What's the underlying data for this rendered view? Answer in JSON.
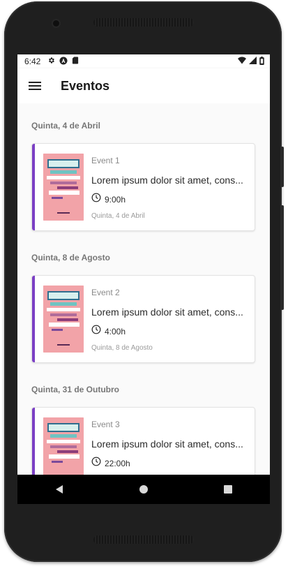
{
  "status_bar": {
    "time": "6:42",
    "icons": [
      "gear-icon",
      "a-badge-icon",
      "sd-card-icon"
    ],
    "right_icons": [
      "wifi-icon",
      "signal-icon",
      "battery-icon"
    ]
  },
  "app_bar": {
    "title": "Eventos",
    "menu_icon": "hamburger-menu-icon"
  },
  "events": [
    {
      "date_header": "Quinta, 4 de Abril",
      "name": "Event 1",
      "description": "Lorem ipsum dolor sit amet, cons...",
      "time": "9:00h",
      "date": "Quinta, 4 de Abril"
    },
    {
      "date_header": "Quinta, 8 de Agosto",
      "name": "Event 2",
      "description": "Lorem ipsum dolor sit amet, cons...",
      "time": "4:00h",
      "date": "Quinta, 8 de Agosto"
    },
    {
      "date_header": "Quinta, 31 de Outubro",
      "name": "Event 3",
      "description": "Lorem ipsum dolor sit amet, cons...",
      "time": "22:00h",
      "date": ""
    }
  ],
  "colors": {
    "accent": "#7b3fc4",
    "poster_bg": "#f2a3a8",
    "nav_bar": "#000000"
  },
  "nav_bar": {
    "buttons": [
      "back-icon",
      "home-icon",
      "recents-icon"
    ]
  }
}
